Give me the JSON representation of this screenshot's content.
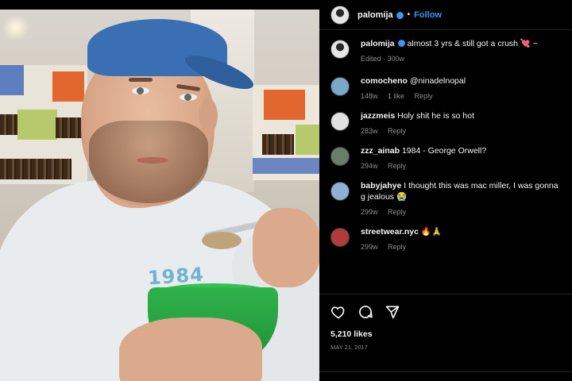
{
  "post": {
    "username": "palomija",
    "follow_label": "Follow",
    "separator": "•",
    "shirt_print": "1984",
    "caption": {
      "username": "palomija",
      "text": "almost 3 yrs & still got a crush 💘 ~",
      "meta": "Edited · 300w"
    },
    "likes": "5,210 likes",
    "date": "May 21, 2017"
  },
  "comments": [
    {
      "username": "comocheno",
      "text": "@ninadelnopal",
      "time": "148w",
      "likes": "1 like",
      "reply": "Reply",
      "avatar_color": "#7aa8c9"
    },
    {
      "username": "jazzmeis",
      "text": "Holy shit he is so hot",
      "time": "283w",
      "likes": "",
      "reply": "Reply",
      "avatar_color": "#e0e0e0"
    },
    {
      "username": "zzz_ainab",
      "text": "1984 - George Orwell?",
      "time": "294w",
      "likes": "",
      "reply": "Reply",
      "avatar_color": "#6a7d6a"
    },
    {
      "username": "babyjahye",
      "text": "I thought this was mac miller, I was gonna g jealous 😭",
      "time": "299w",
      "likes": "",
      "reply": "Reply",
      "avatar_color": "#8fb0d6"
    },
    {
      "username": "streetwear.nyc",
      "text": "🔥🙏",
      "time": "299w",
      "likes": "",
      "reply": "Reply",
      "avatar_color": "#b23a3a"
    }
  ],
  "icons": {
    "like": "heart-icon",
    "comment": "comment-icon",
    "share": "share-icon"
  },
  "colors": {
    "background": "#000000",
    "accent": "#3897f0",
    "muted": "#8e8e8e"
  }
}
